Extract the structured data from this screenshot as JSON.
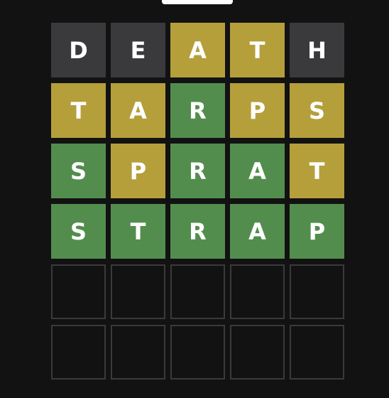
{
  "colors": {
    "background": "#121213",
    "absent": "#3a3a3c",
    "present": "#b59f3b",
    "correct": "#538d4e",
    "empty_border": "#3a3a3c",
    "letter": "#ffffff"
  },
  "board": {
    "rows": [
      {
        "tiles": [
          {
            "letter": "D",
            "state": "absent"
          },
          {
            "letter": "E",
            "state": "absent"
          },
          {
            "letter": "A",
            "state": "present"
          },
          {
            "letter": "T",
            "state": "present"
          },
          {
            "letter": "H",
            "state": "absent"
          }
        ]
      },
      {
        "tiles": [
          {
            "letter": "T",
            "state": "present"
          },
          {
            "letter": "A",
            "state": "present"
          },
          {
            "letter": "R",
            "state": "correct"
          },
          {
            "letter": "P",
            "state": "present"
          },
          {
            "letter": "S",
            "state": "present"
          }
        ]
      },
      {
        "tiles": [
          {
            "letter": "S",
            "state": "correct"
          },
          {
            "letter": "P",
            "state": "present"
          },
          {
            "letter": "R",
            "state": "correct"
          },
          {
            "letter": "A",
            "state": "correct"
          },
          {
            "letter": "T",
            "state": "present"
          }
        ]
      },
      {
        "tiles": [
          {
            "letter": "S",
            "state": "correct"
          },
          {
            "letter": "T",
            "state": "correct"
          },
          {
            "letter": "R",
            "state": "correct"
          },
          {
            "letter": "A",
            "state": "correct"
          },
          {
            "letter": "P",
            "state": "correct"
          }
        ]
      },
      {
        "tiles": [
          {
            "letter": "",
            "state": "empty"
          },
          {
            "letter": "",
            "state": "empty"
          },
          {
            "letter": "",
            "state": "empty"
          },
          {
            "letter": "",
            "state": "empty"
          },
          {
            "letter": "",
            "state": "empty"
          }
        ]
      },
      {
        "tiles": [
          {
            "letter": "",
            "state": "empty"
          },
          {
            "letter": "",
            "state": "empty"
          },
          {
            "letter": "",
            "state": "empty"
          },
          {
            "letter": "",
            "state": "empty"
          },
          {
            "letter": "",
            "state": "empty"
          }
        ]
      }
    ]
  }
}
